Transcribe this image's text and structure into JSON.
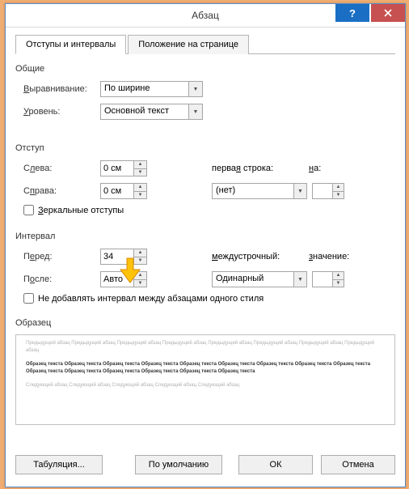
{
  "title": "Абзац",
  "tabs": [
    {
      "label": "Отступы и интервалы"
    },
    {
      "label": "Положение на странице"
    }
  ],
  "general": {
    "label": "Общие",
    "alignment_label": "Выравнивание:",
    "alignment_value": "По ширине",
    "level_label": "Уровень:",
    "level_value": "Основной текст"
  },
  "indent": {
    "label": "Отступ",
    "left_label": "Слева:",
    "left_value": "0 см",
    "right_label": "Справа:",
    "right_value": "0 см",
    "firstline_label": "первая строка:",
    "firstline_value": "(нет)",
    "by_label": "на:",
    "by_value": "",
    "mirror_label": "Зеркальные отступы"
  },
  "spacing": {
    "label": "Интервал",
    "before_label": "Перед:",
    "before_value": "34",
    "after_label": "После:",
    "after_value": "Авто",
    "line_label": "междустрочный:",
    "line_value": "Одинарный",
    "at_label": "значение:",
    "at_value": "",
    "noadd_label": "Не добавлять интервал между абзацами одного стиля"
  },
  "preview": {
    "label": "Образец",
    "prev_para": "Предыдущий абзац Предыдущий абзац Предыдущий абзац Предыдущий абзац Предыдущий абзац Предыдущий абзац Предыдущий абзац Предыдущий абзац",
    "sample": "Образец текста Образец текста Образец текста Образец текста Образец текста Образец текста Образец текста Образец текста Образец текста Образец текста Образец текста Образец текста Образец текста Образец текста Образец текста",
    "next_para": "Следующий абзац Следующий абзац Следующий абзац Следующий абзац Следующий абзац"
  },
  "buttons": {
    "tabs": "Табуляция...",
    "default": "По умолчанию",
    "ok": "ОК",
    "cancel": "Отмена"
  }
}
